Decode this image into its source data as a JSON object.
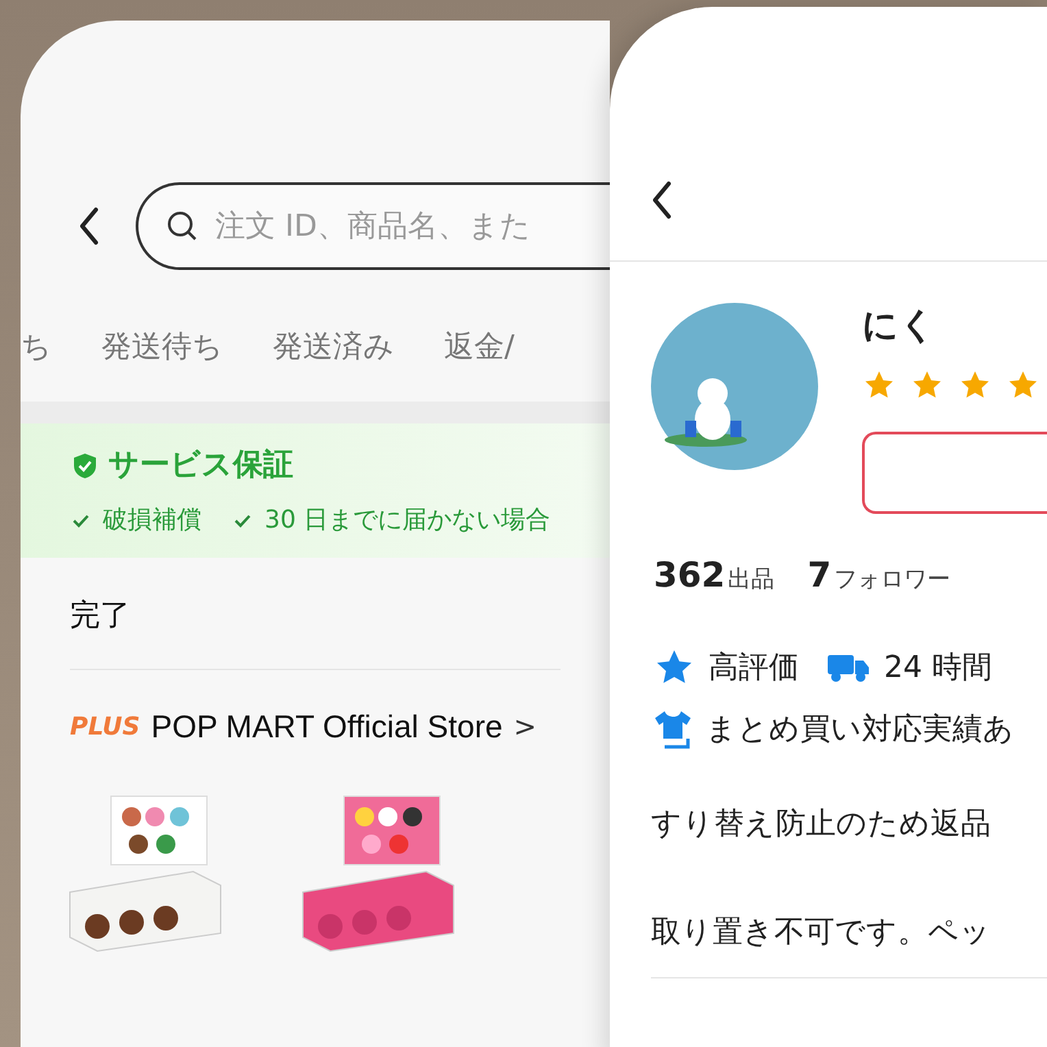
{
  "orders_screen": {
    "search": {
      "placeholder": "注文 ID、商品名、また"
    },
    "tabs": [
      {
        "label": "ち",
        "selected": false
      },
      {
        "label": "発送待ち",
        "selected": false
      },
      {
        "label": "発送済み",
        "selected": false
      },
      {
        "label": "返金/",
        "selected": false
      }
    ],
    "guarantee": {
      "title": "サービス保証",
      "items": [
        "破損補償",
        "30 日までに届かない場合"
      ]
    },
    "status": "完了",
    "store": {
      "badge": "PLUS",
      "name": "POP MART Official Store",
      "arrow": ">"
    }
  },
  "seller_screen": {
    "name": "にく",
    "stars": 4,
    "stats": [
      {
        "count": "362",
        "unit": "出品"
      },
      {
        "count": "7",
        "unit": "フォロワー"
      }
    ],
    "badges": [
      {
        "kind": "star",
        "label": "高評価"
      },
      {
        "kind": "truck",
        "label": "24 時間"
      },
      {
        "kind": "shirt",
        "label": "まとめ買い対応実績あ"
      }
    ],
    "notes": [
      "すり替え防止のため返品",
      "取り置き不可です。ペッ"
    ]
  }
}
